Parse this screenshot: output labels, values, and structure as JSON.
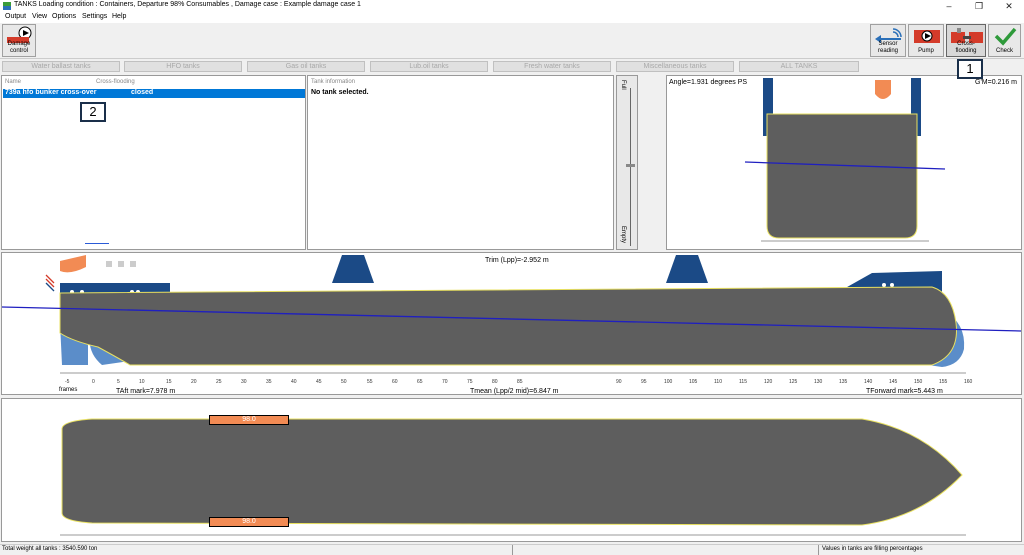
{
  "title": "TANKS  Loading condition : Containers, Departure 98% Consumables , Damage case : Example damage case 1",
  "menu": [
    "Output",
    "View",
    "Options",
    "Settings",
    "Help"
  ],
  "window_controls": [
    "–",
    "❐",
    "✕"
  ],
  "toolbar": {
    "damage_control": "Damage control",
    "sensor_reading": "Sensor reading",
    "pump": "Pump",
    "cross_flooding": "Cross-flooding",
    "check": "Check"
  },
  "tabs": [
    "Water ballast tanks",
    "HFO tanks",
    "Gas oil tanks",
    "Lub.oil tanks",
    "Fresh water tanks",
    "Miscellaneous tanks",
    "ALL TANKS"
  ],
  "list": {
    "col_name": "Name",
    "col_status": "Cross-flooding",
    "row_name": "739a hfo bunker cross-over",
    "row_status": "closed"
  },
  "tank_info": {
    "header": "Tank information",
    "message": "No tank selected."
  },
  "gauge": {
    "top": "Full",
    "bottom": "Empty"
  },
  "section_view": {
    "angle": "Angle=1.931 degrees PS",
    "gm": "G'M=0.216 m"
  },
  "profile_view": {
    "trim": "Trim (Lpp)=-2.952 m",
    "frames_label": "frames",
    "frame_ticks": [
      "-5",
      "0",
      "5",
      "10",
      "15",
      "20",
      "25",
      "30",
      "35",
      "40",
      "45",
      "50",
      "55",
      "60",
      "65",
      "70",
      "75",
      "80",
      "85",
      "90",
      "95",
      "100",
      "105",
      "110",
      "115",
      "120",
      "125",
      "130",
      "135",
      "140",
      "145",
      "150",
      "155",
      "160"
    ],
    "taft": "TAft mark=7.978 m",
    "tmean": "Tmean (Lpp/2 mid)=6.847 m",
    "tforward": "TForward mark=5.443 m"
  },
  "plan_view": {
    "tank_top_value": "98.0",
    "tank_bottom_value": "98.0"
  },
  "callouts": [
    "1",
    "2"
  ],
  "status": {
    "total_weight": "Total weight all tanks :  3540.590 ton",
    "values_note": "Values in tanks are filling percentages"
  },
  "colors": {
    "hull": "#5e5e5e",
    "hull_outline": "#e8e060",
    "waterline": "#1f1fc0",
    "superstructure_blue": "#1b4a86",
    "water_blue": "#5b8dc9",
    "tank_orange": "#f28b54",
    "selection_blue": "#0078d7"
  }
}
